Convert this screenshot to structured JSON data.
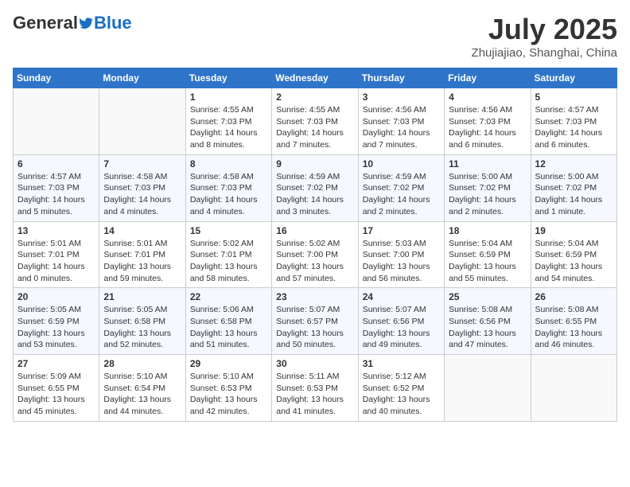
{
  "header": {
    "logo_general": "General",
    "logo_blue": "Blue",
    "month_title": "July 2025",
    "location": "Zhujiajiao, Shanghai, China"
  },
  "days_of_week": [
    "Sunday",
    "Monday",
    "Tuesday",
    "Wednesday",
    "Thursday",
    "Friday",
    "Saturday"
  ],
  "weeks": [
    [
      {
        "day": "",
        "info": ""
      },
      {
        "day": "",
        "info": ""
      },
      {
        "day": "1",
        "info": "Sunrise: 4:55 AM\nSunset: 7:03 PM\nDaylight: 14 hours and 8 minutes."
      },
      {
        "day": "2",
        "info": "Sunrise: 4:55 AM\nSunset: 7:03 PM\nDaylight: 14 hours and 7 minutes."
      },
      {
        "day": "3",
        "info": "Sunrise: 4:56 AM\nSunset: 7:03 PM\nDaylight: 14 hours and 7 minutes."
      },
      {
        "day": "4",
        "info": "Sunrise: 4:56 AM\nSunset: 7:03 PM\nDaylight: 14 hours and 6 minutes."
      },
      {
        "day": "5",
        "info": "Sunrise: 4:57 AM\nSunset: 7:03 PM\nDaylight: 14 hours and 6 minutes."
      }
    ],
    [
      {
        "day": "6",
        "info": "Sunrise: 4:57 AM\nSunset: 7:03 PM\nDaylight: 14 hours and 5 minutes."
      },
      {
        "day": "7",
        "info": "Sunrise: 4:58 AM\nSunset: 7:03 PM\nDaylight: 14 hours and 4 minutes."
      },
      {
        "day": "8",
        "info": "Sunrise: 4:58 AM\nSunset: 7:03 PM\nDaylight: 14 hours and 4 minutes."
      },
      {
        "day": "9",
        "info": "Sunrise: 4:59 AM\nSunset: 7:02 PM\nDaylight: 14 hours and 3 minutes."
      },
      {
        "day": "10",
        "info": "Sunrise: 4:59 AM\nSunset: 7:02 PM\nDaylight: 14 hours and 2 minutes."
      },
      {
        "day": "11",
        "info": "Sunrise: 5:00 AM\nSunset: 7:02 PM\nDaylight: 14 hours and 2 minutes."
      },
      {
        "day": "12",
        "info": "Sunrise: 5:00 AM\nSunset: 7:02 PM\nDaylight: 14 hours and 1 minute."
      }
    ],
    [
      {
        "day": "13",
        "info": "Sunrise: 5:01 AM\nSunset: 7:01 PM\nDaylight: 14 hours and 0 minutes."
      },
      {
        "day": "14",
        "info": "Sunrise: 5:01 AM\nSunset: 7:01 PM\nDaylight: 13 hours and 59 minutes."
      },
      {
        "day": "15",
        "info": "Sunrise: 5:02 AM\nSunset: 7:01 PM\nDaylight: 13 hours and 58 minutes."
      },
      {
        "day": "16",
        "info": "Sunrise: 5:02 AM\nSunset: 7:00 PM\nDaylight: 13 hours and 57 minutes."
      },
      {
        "day": "17",
        "info": "Sunrise: 5:03 AM\nSunset: 7:00 PM\nDaylight: 13 hours and 56 minutes."
      },
      {
        "day": "18",
        "info": "Sunrise: 5:04 AM\nSunset: 6:59 PM\nDaylight: 13 hours and 55 minutes."
      },
      {
        "day": "19",
        "info": "Sunrise: 5:04 AM\nSunset: 6:59 PM\nDaylight: 13 hours and 54 minutes."
      }
    ],
    [
      {
        "day": "20",
        "info": "Sunrise: 5:05 AM\nSunset: 6:59 PM\nDaylight: 13 hours and 53 minutes."
      },
      {
        "day": "21",
        "info": "Sunrise: 5:05 AM\nSunset: 6:58 PM\nDaylight: 13 hours and 52 minutes."
      },
      {
        "day": "22",
        "info": "Sunrise: 5:06 AM\nSunset: 6:58 PM\nDaylight: 13 hours and 51 minutes."
      },
      {
        "day": "23",
        "info": "Sunrise: 5:07 AM\nSunset: 6:57 PM\nDaylight: 13 hours and 50 minutes."
      },
      {
        "day": "24",
        "info": "Sunrise: 5:07 AM\nSunset: 6:56 PM\nDaylight: 13 hours and 49 minutes."
      },
      {
        "day": "25",
        "info": "Sunrise: 5:08 AM\nSunset: 6:56 PM\nDaylight: 13 hours and 47 minutes."
      },
      {
        "day": "26",
        "info": "Sunrise: 5:08 AM\nSunset: 6:55 PM\nDaylight: 13 hours and 46 minutes."
      }
    ],
    [
      {
        "day": "27",
        "info": "Sunrise: 5:09 AM\nSunset: 6:55 PM\nDaylight: 13 hours and 45 minutes."
      },
      {
        "day": "28",
        "info": "Sunrise: 5:10 AM\nSunset: 6:54 PM\nDaylight: 13 hours and 44 minutes."
      },
      {
        "day": "29",
        "info": "Sunrise: 5:10 AM\nSunset: 6:53 PM\nDaylight: 13 hours and 42 minutes."
      },
      {
        "day": "30",
        "info": "Sunrise: 5:11 AM\nSunset: 6:53 PM\nDaylight: 13 hours and 41 minutes."
      },
      {
        "day": "31",
        "info": "Sunrise: 5:12 AM\nSunset: 6:52 PM\nDaylight: 13 hours and 40 minutes."
      },
      {
        "day": "",
        "info": ""
      },
      {
        "day": "",
        "info": ""
      }
    ]
  ]
}
